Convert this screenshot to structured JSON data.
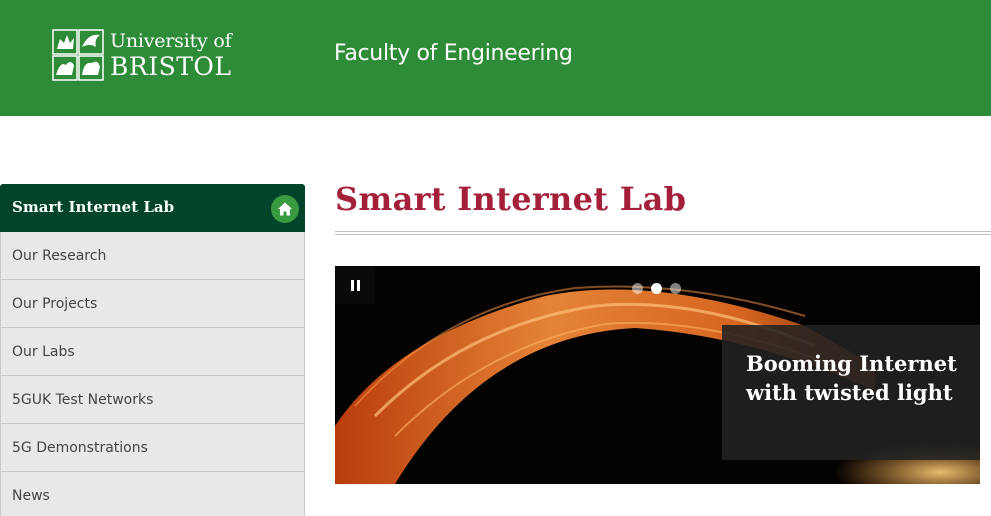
{
  "header": {
    "logo": {
      "line1": "University of",
      "line2": "BRISTOL"
    },
    "faculty": "Faculty of Engineering"
  },
  "sidebar": {
    "heading": "Smart Internet Lab",
    "home_icon": "home-icon",
    "items": [
      {
        "label": "Our Research"
      },
      {
        "label": "Our Projects"
      },
      {
        "label": "Our Labs"
      },
      {
        "label": "5GUK Test Networks"
      },
      {
        "label": "5G Demonstrations"
      },
      {
        "label": "News"
      }
    ]
  },
  "main": {
    "title": "Smart Internet Lab",
    "carousel": {
      "pause_icon": "pause-icon",
      "slides_total": 3,
      "active_slide": 2,
      "caption": "Booming Internet with twisted light"
    }
  },
  "colors": {
    "header_bg": "#2e8b37",
    "sidebar_head_bg": "#00452a",
    "title_color": "#a4203a",
    "sidebar_item_bg": "#e8e8e8"
  }
}
